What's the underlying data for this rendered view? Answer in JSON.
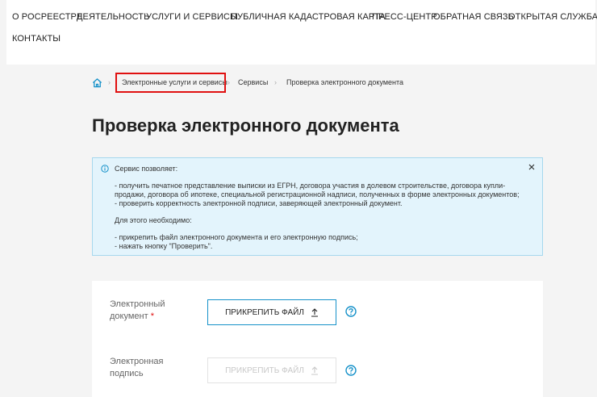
{
  "nav": {
    "row1": [
      "О РОСРЕЕСТРЕ",
      "ДЕЯТЕЛЬНОСТЬ",
      "УСЛУГИ И СЕРВИСЫ",
      "ПУБЛИЧНАЯ КАДАСТРОВАЯ КАРТА",
      "ПРЕСС-ЦЕНТР",
      "ОБРАТНАЯ СВЯЗЬ",
      "ОТКРЫТАЯ СЛУЖБА"
    ],
    "row2": [
      "КОНТАКТЫ"
    ]
  },
  "breadcrumb": {
    "home_icon": "home-icon",
    "items": [
      "Электронные услуги и сервисы",
      "Сервисы",
      "Проверка электронного документа"
    ],
    "separator": "›",
    "highlight_color": "#e01010"
  },
  "page": {
    "title": "Проверка электронного документа"
  },
  "info": {
    "icon": "info-icon",
    "header": "Сервис позволяет:",
    "lines": [
      "- получить печатное представление выписки из ЕГРН, договора участия в долевом строительстве, договора купли-продажи, договора об ипотеке, специальной регистрационной надписи, полученных в форме электронных документов;",
      "- проверить корректность электронной подписи, заверяющей электронный документ."
    ],
    "need_header": "Для этого необходимо:",
    "steps": [
      "- прикрепить файл электронного документа и его электронную подпись;",
      "- нажать кнопку \"Проверить\"."
    ],
    "close_icon": "close-icon",
    "bg_color": "#e3f4fc",
    "border_color": "#a6d8ee"
  },
  "form": {
    "doc": {
      "label_1": "Электронный",
      "label_2": "документ",
      "required": "*",
      "button": "ПРИКРЕПИТЬ ФАЙЛ"
    },
    "sig": {
      "label_1": "Электронная",
      "label_2": "подпись",
      "button": "ПРИКРЕПИТЬ ФАЙЛ"
    },
    "accent_color": "#1591c9",
    "upload_icon": "upload-icon",
    "help_icon": "help-icon"
  }
}
